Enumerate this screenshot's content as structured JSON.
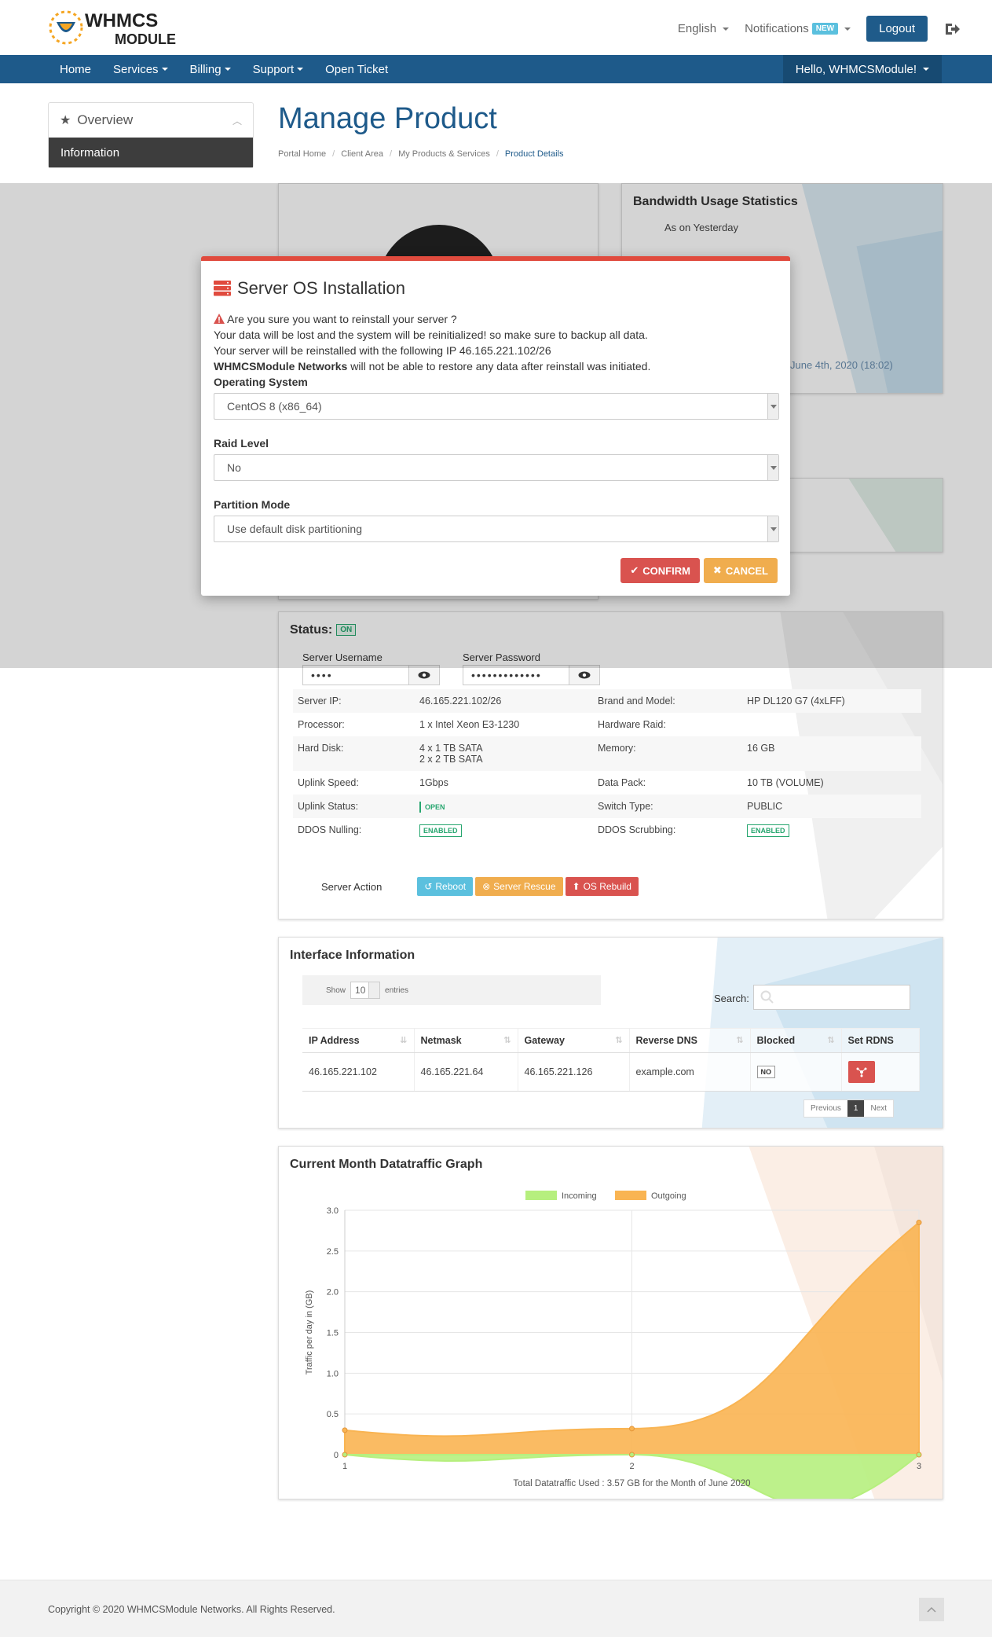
{
  "header": {
    "logo_text_top": "WHMCS",
    "logo_text_bottom": "MODULE",
    "language": "English",
    "notifications": "Notifications",
    "new_badge": "NEW",
    "logout": "Logout"
  },
  "nav": {
    "items": [
      {
        "label": "Home",
        "dropdown": false
      },
      {
        "label": "Services",
        "dropdown": true
      },
      {
        "label": "Billing",
        "dropdown": true
      },
      {
        "label": "Support",
        "dropdown": true
      },
      {
        "label": "Open Ticket",
        "dropdown": false
      }
    ],
    "user": "Hello, WHMCSModule!"
  },
  "sidebar": {
    "title": "Overview",
    "active_item": "Information"
  },
  "page": {
    "title": "Manage Product",
    "breadcrumb": [
      "Portal Home",
      "Client Area",
      "My Products & Services",
      "Product Details"
    ]
  },
  "bandwidth": {
    "title": "Bandwidth Usage Statistics",
    "subtitle": "As on Yesterday",
    "updated": "June 4th, 2020 (18:02)"
  },
  "status": {
    "label": "Status:",
    "value": "ON",
    "username_label": "Server Username",
    "username_value": "••••",
    "password_label": "Server Password",
    "password_value": "•••••••••••••",
    "rows": [
      {
        "k1": "Server IP:",
        "v1": "46.165.221.102/26",
        "k2": "Brand and Model:",
        "v2": "HP DL120 G7 (4xLFF)"
      },
      {
        "k1": "Processor:",
        "v1": "1 x Intel Xeon E3-1230",
        "k2": "Hardware Raid:",
        "v2": ""
      },
      {
        "k1": "Hard Disk:",
        "v1": "4 x 1 TB SATA",
        "v1b": "2 x 2 TB SATA",
        "k2": "Memory:",
        "v2": "16 GB"
      },
      {
        "k1": "Uplink Speed:",
        "v1": "1Gbps",
        "k2": "Data Pack:",
        "v2": "10 TB (VOLUME)"
      },
      {
        "k1": "Uplink Status:",
        "v1": "OPEN",
        "k2": "Switch Type:",
        "v2": "PUBLIC"
      },
      {
        "k1": "DDOS Nulling:",
        "v1": "ENABLED",
        "k2": "DDOS Scrubbing:",
        "v2": "ENABLED"
      }
    ],
    "action_label": "Server Action",
    "reboot": "Reboot",
    "rescue": "Server Rescue",
    "rebuild": "OS Rebuild"
  },
  "interface": {
    "title": "Interface Information",
    "show": "Show",
    "entries_value": "10",
    "entries": "entries",
    "search": "Search:",
    "columns": [
      "IP Address",
      "Netmask",
      "Gateway",
      "Reverse DNS",
      "Blocked",
      "Set RDNS"
    ],
    "row": {
      "ip": "46.165.221.102",
      "netmask": "46.165.221.64",
      "gateway": "46.165.221.126",
      "rdns": "example.com",
      "blocked": "NO"
    },
    "prev": "Previous",
    "page": "1",
    "next": "Next"
  },
  "traffic": {
    "title": "Current Month Datatraffic Graph"
  },
  "chart_data": {
    "type": "area",
    "title": "",
    "x": [
      1,
      2,
      3
    ],
    "xticks": [
      "1",
      "2",
      "3"
    ],
    "yticks": [
      "0",
      "0.5",
      "1.0",
      "1.5",
      "2.0",
      "2.5",
      "3.0"
    ],
    "ylim": [
      0,
      3.0
    ],
    "ylabel": "Traffic per day in (GB)",
    "xlabel": "Total Datatraffic Used : 3.57 GB for the Month of June 2020",
    "legend_position": "top-center",
    "series": [
      {
        "name": "Incoming",
        "color": "#b6ef7e",
        "values": [
          0.0,
          0.0,
          0.0
        ]
      },
      {
        "name": "Outgoing",
        "color": "#f9b452",
        "values": [
          0.3,
          0.32,
          2.85
        ]
      }
    ]
  },
  "footer": {
    "copyright": "Copyright © 2020 WHMCSModule Networks. All Rights Reserved."
  },
  "modal": {
    "title": "Server OS Installation",
    "warning": "Are you sure you want to reinstall your server ?",
    "line2": "Your data will be lost and the system will be reinitialized! so make sure to backup all data.",
    "line3": "Your server will be reinstalled with the following IP 46.165.221.102/26",
    "line4_bold": "WHMCSModule Networks",
    "line4_rest": " will not be able to restore any data after reinstall was initiated.",
    "os_label": "Operating System",
    "os_value": "CentOS 8 (x86_64)",
    "raid_label": "Raid Level",
    "raid_value": "No",
    "partition_label": "Partition Mode",
    "partition_value": "Use default disk partitioning",
    "confirm": "CONFIRM",
    "cancel": "CANCEL"
  },
  "colors": {
    "brand": "#1e5a8a",
    "danger": "#d9534f",
    "warning": "#f0ad4e",
    "info": "#5bc0de",
    "success": "#27a66f"
  }
}
